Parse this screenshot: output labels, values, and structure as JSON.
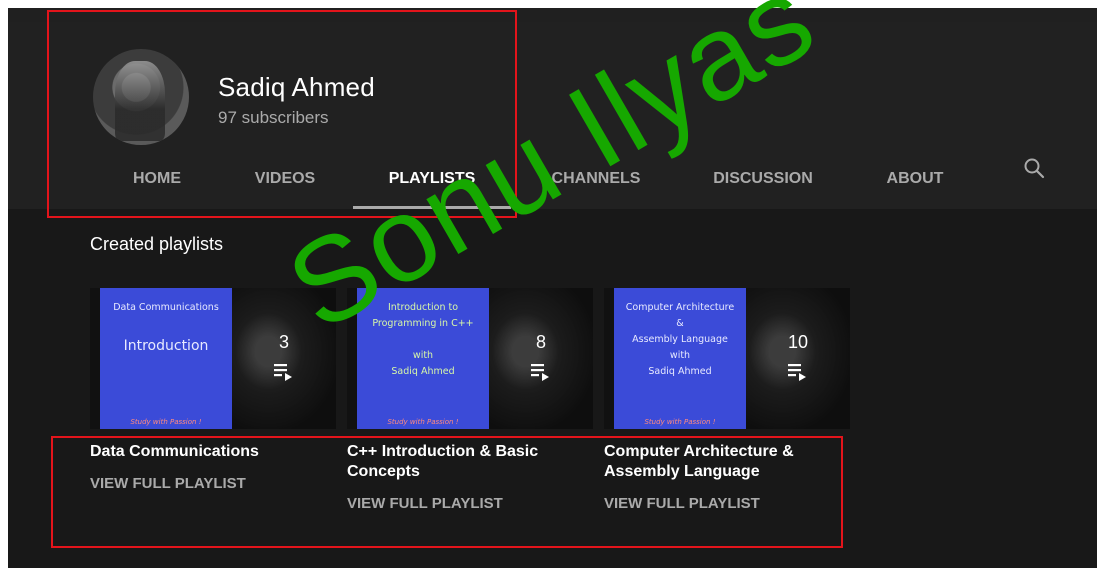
{
  "channel": {
    "name": "Sadiq Ahmed",
    "subscribers": "97 subscribers"
  },
  "tabs": [
    {
      "label": "HOME",
      "active": false
    },
    {
      "label": "VIDEOS",
      "active": false
    },
    {
      "label": "PLAYLISTS",
      "active": true
    },
    {
      "label": "CHANNELS",
      "active": false
    },
    {
      "label": "DISCUSSION",
      "active": false
    },
    {
      "label": "ABOUT",
      "active": false
    }
  ],
  "search_icon": "search-icon",
  "section_title": "Created playlists",
  "playlists": [
    {
      "title": "Data Communications",
      "thumb_text": "Data Communications",
      "thumb_big": "Introduction",
      "thumb_footer": "Study with Passion !",
      "video_count": "3",
      "link_label": "VIEW FULL PLAYLIST"
    },
    {
      "title": "C++ Introduction & Basic Concepts",
      "thumb_text": "Introduction to\nProgramming in C++\n\nwith\nSadiq Ahmed",
      "thumb_big": "",
      "thumb_footer": "Study with Passion !",
      "video_count": "8",
      "link_label": "VIEW FULL PLAYLIST"
    },
    {
      "title": "Computer Architecture & Assembly Language",
      "thumb_text": "Computer Architecture\n&\nAssembly Language\nwith\nSadiq Ahmed",
      "thumb_big": "",
      "thumb_footer": "Study with Passion !",
      "video_count": "10",
      "link_label": "VIEW FULL PLAYLIST"
    }
  ],
  "watermark": "Sonu Ilyas",
  "colors": {
    "background": "#181818",
    "header": "#212121",
    "annotation": "#e3141b",
    "watermark": "#16a800",
    "slide": "#3b4bd8"
  }
}
